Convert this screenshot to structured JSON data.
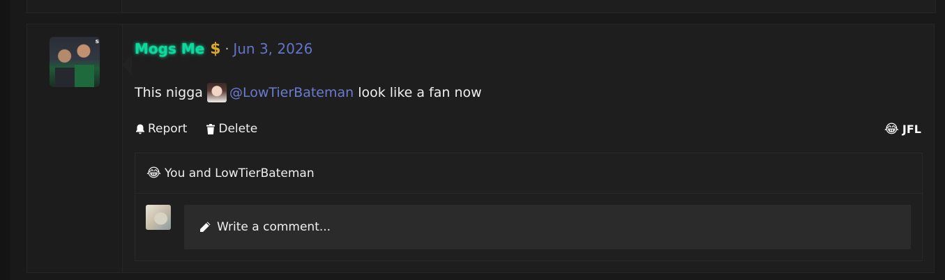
{
  "post": {
    "username": "Mogs Me",
    "badge_icon": "dollar-sign-icon",
    "badge_symbol": "$",
    "separator": "·",
    "date": "Jun 3, 2026",
    "message_prefix": "This nigga",
    "mention": "@LowTierBateman",
    "message_suffix": "look like a fan now"
  },
  "actions": {
    "report_label": "Report",
    "delete_label": "Delete"
  },
  "reactions": {
    "emoji": "😂",
    "label": "JFL",
    "reacted_by_text": "You and LowTierBateman"
  },
  "comment": {
    "placeholder": "Write a comment..."
  },
  "colors": {
    "username": "#0fd89c",
    "date": "#6275c8",
    "mention": "#6a7ccf",
    "background": "#191919",
    "panel": "#1e1e1e"
  }
}
